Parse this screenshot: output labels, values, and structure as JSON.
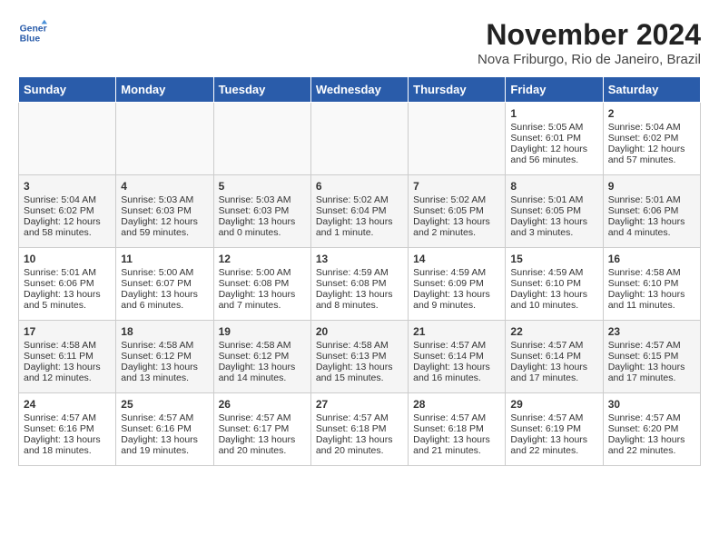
{
  "header": {
    "logo_line1": "General",
    "logo_line2": "Blue",
    "month": "November 2024",
    "location": "Nova Friburgo, Rio de Janeiro, Brazil"
  },
  "weekdays": [
    "Sunday",
    "Monday",
    "Tuesday",
    "Wednesday",
    "Thursday",
    "Friday",
    "Saturday"
  ],
  "weeks": [
    [
      {
        "day": "",
        "sunrise": "",
        "sunset": "",
        "daylight": ""
      },
      {
        "day": "",
        "sunrise": "",
        "sunset": "",
        "daylight": ""
      },
      {
        "day": "",
        "sunrise": "",
        "sunset": "",
        "daylight": ""
      },
      {
        "day": "",
        "sunrise": "",
        "sunset": "",
        "daylight": ""
      },
      {
        "day": "",
        "sunrise": "",
        "sunset": "",
        "daylight": ""
      },
      {
        "day": "1",
        "sunrise": "Sunrise: 5:05 AM",
        "sunset": "Sunset: 6:01 PM",
        "daylight": "Daylight: 12 hours and 56 minutes."
      },
      {
        "day": "2",
        "sunrise": "Sunrise: 5:04 AM",
        "sunset": "Sunset: 6:02 PM",
        "daylight": "Daylight: 12 hours and 57 minutes."
      }
    ],
    [
      {
        "day": "3",
        "sunrise": "Sunrise: 5:04 AM",
        "sunset": "Sunset: 6:02 PM",
        "daylight": "Daylight: 12 hours and 58 minutes."
      },
      {
        "day": "4",
        "sunrise": "Sunrise: 5:03 AM",
        "sunset": "Sunset: 6:03 PM",
        "daylight": "Daylight: 12 hours and 59 minutes."
      },
      {
        "day": "5",
        "sunrise": "Sunrise: 5:03 AM",
        "sunset": "Sunset: 6:03 PM",
        "daylight": "Daylight: 13 hours and 0 minutes."
      },
      {
        "day": "6",
        "sunrise": "Sunrise: 5:02 AM",
        "sunset": "Sunset: 6:04 PM",
        "daylight": "Daylight: 13 hours and 1 minute."
      },
      {
        "day": "7",
        "sunrise": "Sunrise: 5:02 AM",
        "sunset": "Sunset: 6:05 PM",
        "daylight": "Daylight: 13 hours and 2 minutes."
      },
      {
        "day": "8",
        "sunrise": "Sunrise: 5:01 AM",
        "sunset": "Sunset: 6:05 PM",
        "daylight": "Daylight: 13 hours and 3 minutes."
      },
      {
        "day": "9",
        "sunrise": "Sunrise: 5:01 AM",
        "sunset": "Sunset: 6:06 PM",
        "daylight": "Daylight: 13 hours and 4 minutes."
      }
    ],
    [
      {
        "day": "10",
        "sunrise": "Sunrise: 5:01 AM",
        "sunset": "Sunset: 6:06 PM",
        "daylight": "Daylight: 13 hours and 5 minutes."
      },
      {
        "day": "11",
        "sunrise": "Sunrise: 5:00 AM",
        "sunset": "Sunset: 6:07 PM",
        "daylight": "Daylight: 13 hours and 6 minutes."
      },
      {
        "day": "12",
        "sunrise": "Sunrise: 5:00 AM",
        "sunset": "Sunset: 6:08 PM",
        "daylight": "Daylight: 13 hours and 7 minutes."
      },
      {
        "day": "13",
        "sunrise": "Sunrise: 4:59 AM",
        "sunset": "Sunset: 6:08 PM",
        "daylight": "Daylight: 13 hours and 8 minutes."
      },
      {
        "day": "14",
        "sunrise": "Sunrise: 4:59 AM",
        "sunset": "Sunset: 6:09 PM",
        "daylight": "Daylight: 13 hours and 9 minutes."
      },
      {
        "day": "15",
        "sunrise": "Sunrise: 4:59 AM",
        "sunset": "Sunset: 6:10 PM",
        "daylight": "Daylight: 13 hours and 10 minutes."
      },
      {
        "day": "16",
        "sunrise": "Sunrise: 4:58 AM",
        "sunset": "Sunset: 6:10 PM",
        "daylight": "Daylight: 13 hours and 11 minutes."
      }
    ],
    [
      {
        "day": "17",
        "sunrise": "Sunrise: 4:58 AM",
        "sunset": "Sunset: 6:11 PM",
        "daylight": "Daylight: 13 hours and 12 minutes."
      },
      {
        "day": "18",
        "sunrise": "Sunrise: 4:58 AM",
        "sunset": "Sunset: 6:12 PM",
        "daylight": "Daylight: 13 hours and 13 minutes."
      },
      {
        "day": "19",
        "sunrise": "Sunrise: 4:58 AM",
        "sunset": "Sunset: 6:12 PM",
        "daylight": "Daylight: 13 hours and 14 minutes."
      },
      {
        "day": "20",
        "sunrise": "Sunrise: 4:58 AM",
        "sunset": "Sunset: 6:13 PM",
        "daylight": "Daylight: 13 hours and 15 minutes."
      },
      {
        "day": "21",
        "sunrise": "Sunrise: 4:57 AM",
        "sunset": "Sunset: 6:14 PM",
        "daylight": "Daylight: 13 hours and 16 minutes."
      },
      {
        "day": "22",
        "sunrise": "Sunrise: 4:57 AM",
        "sunset": "Sunset: 6:14 PM",
        "daylight": "Daylight: 13 hours and 17 minutes."
      },
      {
        "day": "23",
        "sunrise": "Sunrise: 4:57 AM",
        "sunset": "Sunset: 6:15 PM",
        "daylight": "Daylight: 13 hours and 17 minutes."
      }
    ],
    [
      {
        "day": "24",
        "sunrise": "Sunrise: 4:57 AM",
        "sunset": "Sunset: 6:16 PM",
        "daylight": "Daylight: 13 hours and 18 minutes."
      },
      {
        "day": "25",
        "sunrise": "Sunrise: 4:57 AM",
        "sunset": "Sunset: 6:16 PM",
        "daylight": "Daylight: 13 hours and 19 minutes."
      },
      {
        "day": "26",
        "sunrise": "Sunrise: 4:57 AM",
        "sunset": "Sunset: 6:17 PM",
        "daylight": "Daylight: 13 hours and 20 minutes."
      },
      {
        "day": "27",
        "sunrise": "Sunrise: 4:57 AM",
        "sunset": "Sunset: 6:18 PM",
        "daylight": "Daylight: 13 hours and 20 minutes."
      },
      {
        "day": "28",
        "sunrise": "Sunrise: 4:57 AM",
        "sunset": "Sunset: 6:18 PM",
        "daylight": "Daylight: 13 hours and 21 minutes."
      },
      {
        "day": "29",
        "sunrise": "Sunrise: 4:57 AM",
        "sunset": "Sunset: 6:19 PM",
        "daylight": "Daylight: 13 hours and 22 minutes."
      },
      {
        "day": "30",
        "sunrise": "Sunrise: 4:57 AM",
        "sunset": "Sunset: 6:20 PM",
        "daylight": "Daylight: 13 hours and 22 minutes."
      }
    ]
  ]
}
